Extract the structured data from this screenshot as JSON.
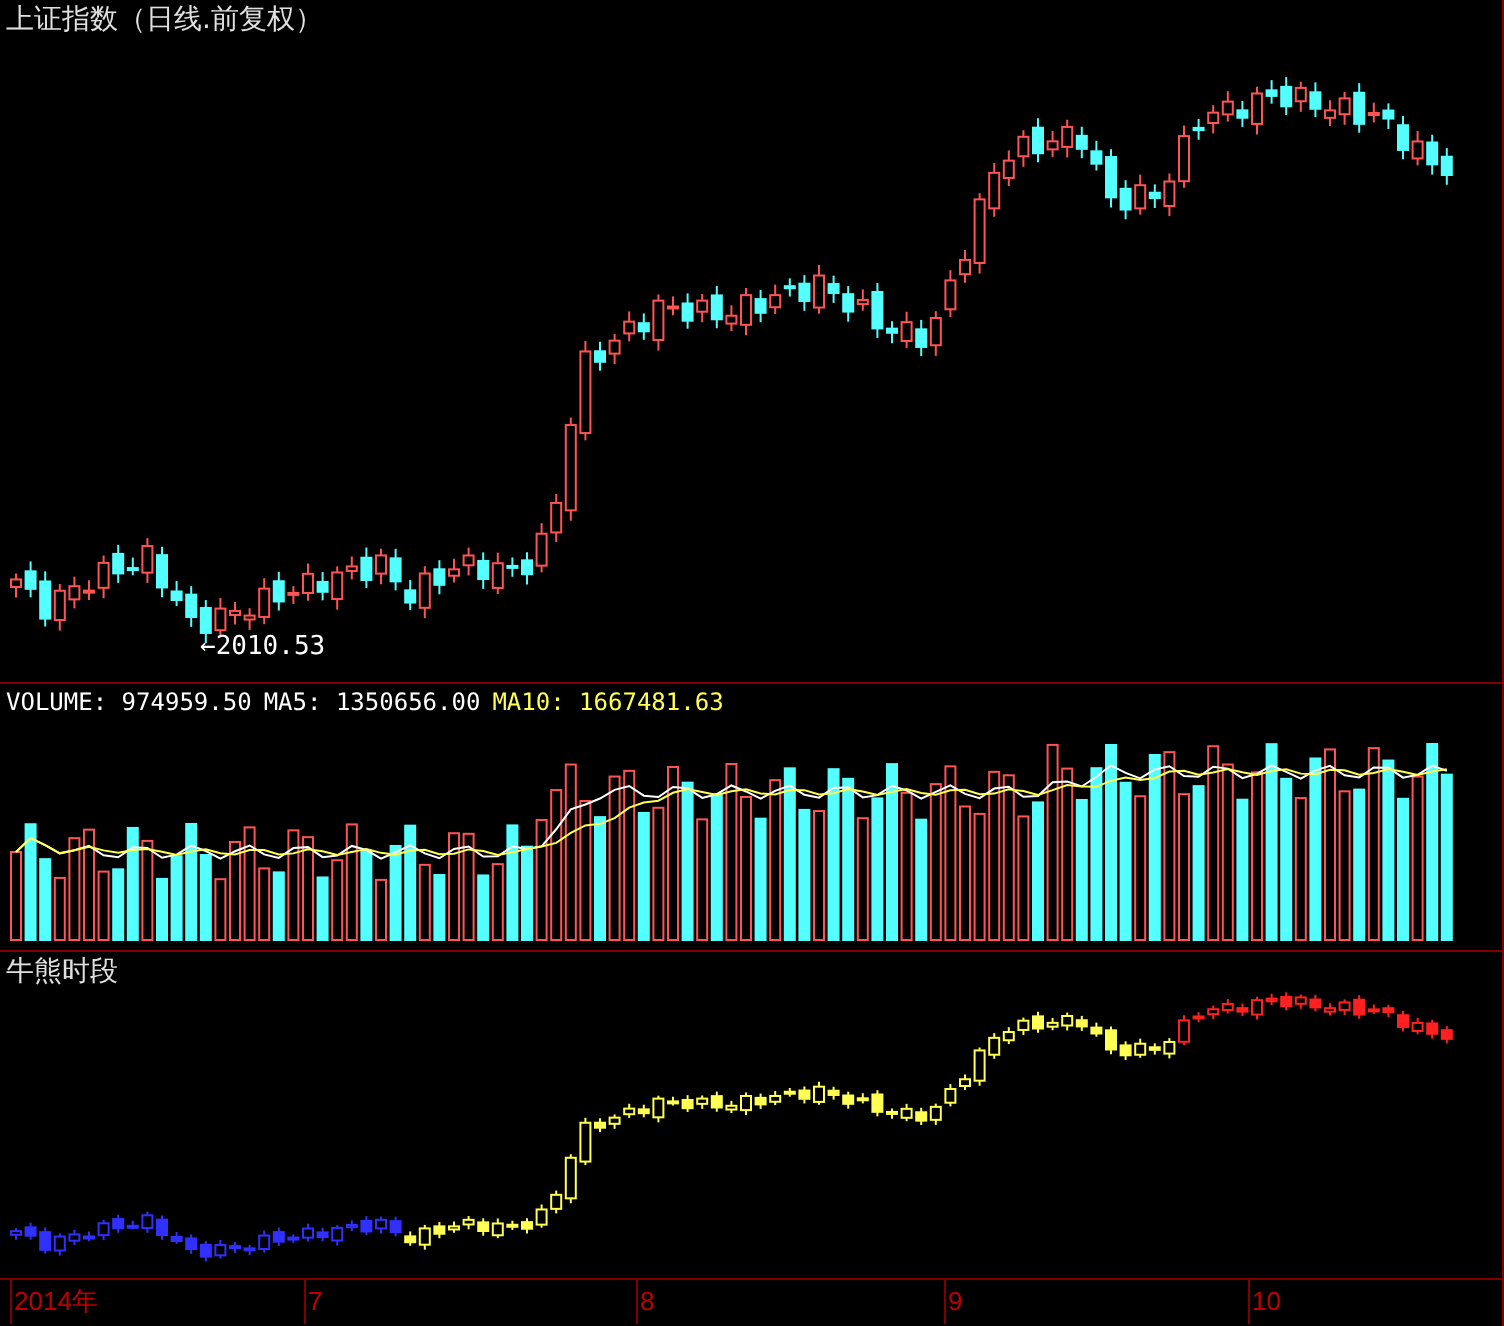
{
  "price_panel": {
    "title": "上证指数（日线.前复权）",
    "low_marker": "←2010.53"
  },
  "volume_panel": {
    "legend": [
      {
        "label": "VOLUME: 974959.50",
        "color": "#ffffff"
      },
      {
        "label": "MA5: 1350656.00",
        "color": "#ffffff"
      },
      {
        "label": "MA10: 1667481.63",
        "color": "#ffff54"
      }
    ]
  },
  "indicator_panel": {
    "title": "牛熊时段"
  },
  "time_axis": {
    "labels": [
      "2014年",
      "7",
      "8",
      "9",
      "10"
    ]
  }
}
